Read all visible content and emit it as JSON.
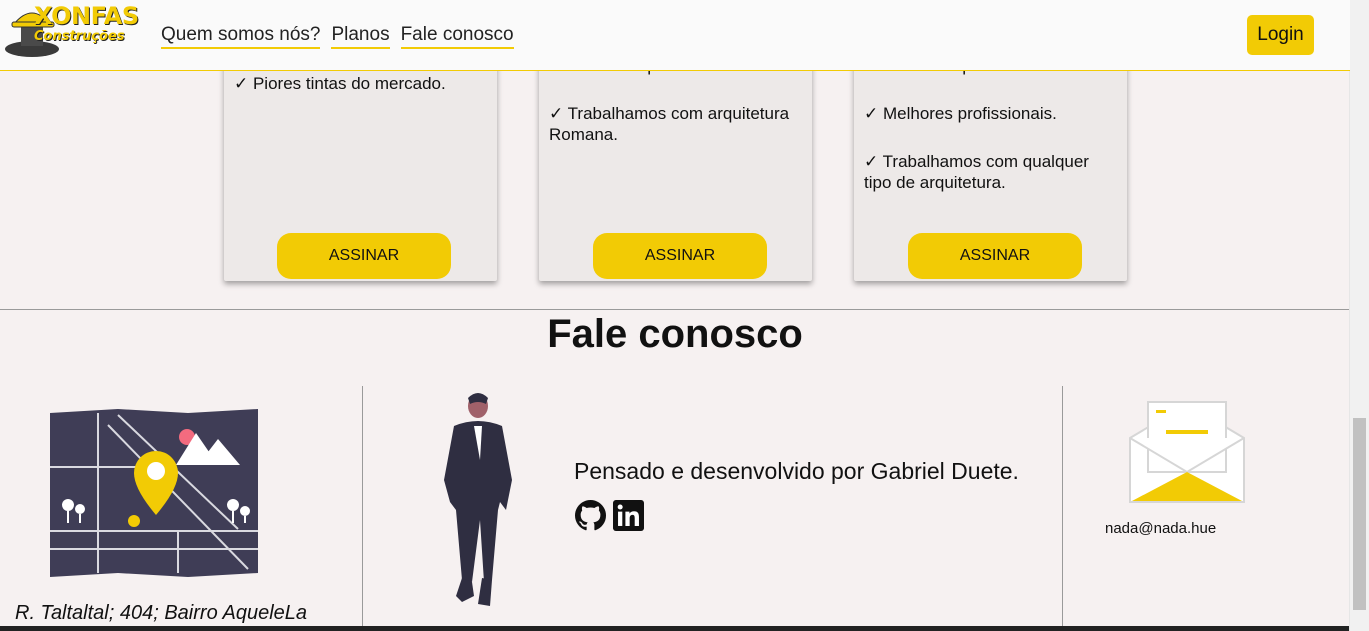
{
  "header": {
    "logo_name": "XONFAS",
    "logo_sub": "Construções",
    "nav": [
      "Quem somos nós?",
      "Planos",
      "Fale conosco"
    ],
    "login": "Login"
  },
  "plans": [
    {
      "features": [
        "✓ Piores tintas do mercado."
      ],
      "button": "ASSINAR"
    },
    {
      "features": [
        "✓ Tintas de qualidade.",
        "✓ Trabalhamos com arquitetura Romana."
      ],
      "button": "ASSINAR"
    },
    {
      "features": [
        "✓ Tintas de qualidade.",
        "✓ Melhores profissionais.",
        "✓ Trabalhamos com qualquer tipo de arquitetura."
      ],
      "button": "ASSINAR"
    }
  ],
  "contact": {
    "title": "Fale conosco",
    "address": "R. Taltaltal; 404; Bairro AqueleLa",
    "author": "Pensado e desenvolvido por Gabriel Duete.",
    "email": "nada@nada.hue"
  },
  "colors": {
    "accent": "#f2cb05",
    "background": "#f6f1f1",
    "card": "#ede9e8",
    "illustration": "#3f3d56"
  },
  "icons": [
    "github-icon",
    "linkedin-icon",
    "map-pin-illustration",
    "envelope-illustration"
  ]
}
